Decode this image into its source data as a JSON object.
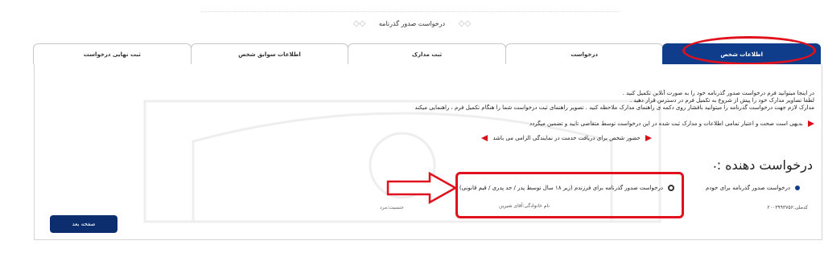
{
  "page_title": "درخواست صدور گذرنامه",
  "tabs": [
    {
      "label": "اطلاعات شخص",
      "active": true
    },
    {
      "label": "درخواست",
      "active": false
    },
    {
      "label": "ثبت مدارک",
      "active": false
    },
    {
      "label": "اطلاعات سوابق شخص",
      "active": false
    },
    {
      "label": "ثبت نهایی درخواست",
      "active": false
    }
  ],
  "info_lines": [
    "در اینجا میتوانید فرم درخواست صدور گذرنامه خود را به صورت آنلاین تکمیل کنید .",
    "لطفا تصاویر مدارک خود را پیش از شروع به تکمیل فرم در دسترس قرار دهید .",
    "مدارک لازم جهت درخواست گذرنامه را میتوانید بافشار روی دکمه ی راهنمای مدارک ملاحظه کنید .  تصویر راهنمای ثبت درخواست شما را هنگام تکمیل فرم ، راهنمایی میکند"
  ],
  "warnings": [
    "بدیهی است صحت و اعتبار تمامی اطلاعات و مدارک ثبت شده در این درخواست توسط متقاضی تایید و تضمین میگردد",
    "حضور شخص برای دریافت خدمت در نمایندگی الزامی می باشد"
  ],
  "section_heading": "درخواست دهنده :",
  "options": [
    {
      "label": "درخواست صدور گذرنامه برای خودم",
      "selected": true
    },
    {
      "label": "درخواست صدور گذرنامه برای فرزندم (زیر ۱۸ سال توسط پدر / جد پدری / قیم قانونی)",
      "selected": false
    }
  ],
  "national_code": "کدملی:۲۰۰۳۹۹۳۷۵۶",
  "surname_line": "نام خانوادگی:آقای شیرین",
  "gender_line": "جنسیت:مرد",
  "next_button": "صفحه بعد",
  "colors": {
    "active_tab": "#0f3d8c",
    "highlight": "#e0101c",
    "button": "#0d2e6e"
  }
}
